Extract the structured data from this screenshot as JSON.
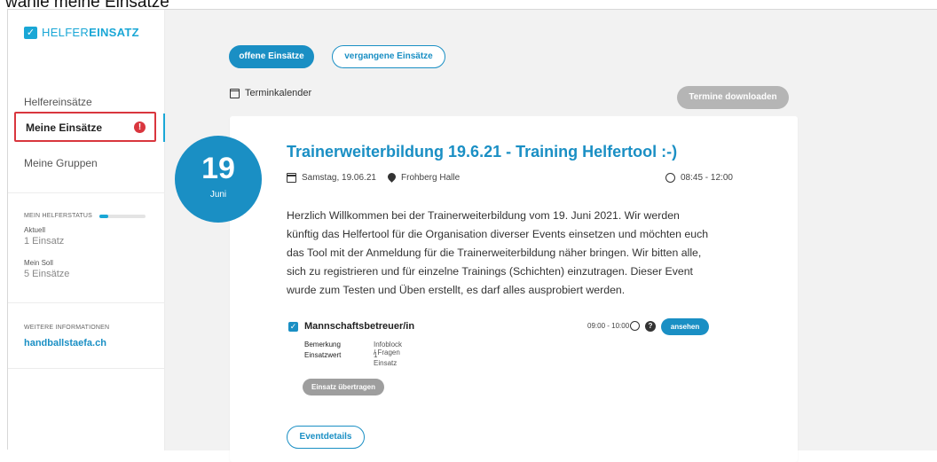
{
  "caption": "wähle meine Einsätze",
  "app": {
    "logo_mark": "✓",
    "logo_part1": "HELFER",
    "logo_part2": "EINSATZ"
  },
  "sidebar": {
    "items": [
      {
        "label": "Helfereinsätze"
      },
      {
        "label": "Meine Einsätze",
        "active": true,
        "alert": "!"
      },
      {
        "label": "Meine Gruppen"
      }
    ],
    "status": {
      "heading": "MEIN HELFERSTATUS",
      "progress_fraction": 0.2,
      "current_label": "Aktuell",
      "current_value": "1 Einsatz",
      "target_label": "Mein Soll",
      "target_value": "5 Einsätze"
    },
    "info": {
      "heading": "WEITERE INFORMATIONEN",
      "link": "handballstaefa.ch"
    }
  },
  "tabs": [
    {
      "label": "offene Einsätze",
      "active": true
    },
    {
      "label": "vergangene Einsätze",
      "active": false
    }
  ],
  "calendar": {
    "label": "Terminkalender",
    "download_label": "Termine downloaden"
  },
  "event": {
    "day": "19",
    "month": "Juni",
    "title": "Trainerweiterbildung 19.6.21 - Training Helfertool :-)",
    "date_text": "Samstag, 19.06.21",
    "location": "Frohberg Halle",
    "time": "08:45 - 12:00",
    "description": "Herzlich Willkommen bei der Trainerweiterbildung vom 19. Juni 2021. Wir werden künftig das Helfertool für die Organisation diverser Events einsetzen und möchten euch das Tool mit der Anmeldung für die Trainerweiterbildung näher bringen. Wir bitten alle, sich zu registrieren und für einzelne Trainings (Schichten) einzutragen. Dieser Event wurde zum Testen und Üben erstellt, es darf alles ausprobiert werden.",
    "shift": {
      "name": "Mannschaftsbetreuer/in",
      "time": "09:00 - 10:00",
      "view_label": "ansehen",
      "remark_key": "Bemerkung",
      "remark_value": "Infoblock / Fragen",
      "value_key": "Einsatzwert",
      "value_value": "1 Einsatz",
      "transfer_label": "Einsatz übertragen"
    },
    "details_label": "Eventdetails"
  },
  "colors": {
    "accent": "#1a8fc4",
    "alert": "#d9363e",
    "muted_button": "#b5b5b5"
  }
}
